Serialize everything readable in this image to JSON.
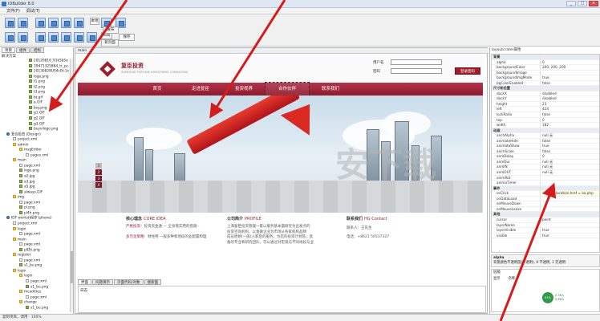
{
  "window": {
    "title": "IDBuilder 8.0",
    "min": "_",
    "max": "□",
    "close": "×"
  },
  "menu": [
    "文件(F)",
    "调试(T)"
  ],
  "toolbar": {
    "labels": [
      "本地",
      "布局",
      "发布",
      "保存",
      "新页面"
    ]
  },
  "left": {
    "tabs": [
      "项目",
      "组件",
      "结构"
    ],
    "heading": "解决方案",
    "tree": [
      {
        "label": "20120816_91k5b5o",
        "indent": 34,
        "kind": "img"
      },
      {
        "label": "39471325864_tr_pc",
        "indent": 34,
        "kind": "img"
      },
      {
        "label": "20130828US4c0t-1x",
        "indent": 34,
        "kind": "img"
      },
      {
        "label": "logo.png",
        "indent": 34,
        "kind": "img"
      },
      {
        "label": "t1.png",
        "indent": 34,
        "kind": "img"
      },
      {
        "label": "t2.png",
        "indent": 34,
        "kind": "img"
      },
      {
        "label": "t3.png",
        "indent": 34,
        "kind": "img"
      },
      {
        "label": "bt.gif",
        "indent": 34,
        "kind": "img"
      },
      {
        "label": "a.GIF",
        "indent": 34,
        "kind": "img"
      },
      {
        "label": "bsy.png",
        "indent": 34,
        "kind": "img"
      },
      {
        "label": "g1.GIF",
        "indent": 34,
        "kind": "img"
      },
      {
        "label": "g2.GIF",
        "indent": 34,
        "kind": "img"
      },
      {
        "label": "g3.GIF",
        "indent": 34,
        "kind": "img"
      },
      {
        "label": "buyvilogo.png",
        "indent": 34,
        "kind": "img"
      },
      {
        "label": "复合投资 (Design)",
        "indent": 6,
        "kind": "proj"
      },
      {
        "label": "project.xml",
        "indent": 14,
        "kind": "file"
      },
      {
        "label": "admin",
        "indent": 14,
        "kind": "folder"
      },
      {
        "label": "msgEditor",
        "indent": 22,
        "kind": "folder"
      },
      {
        "label": "pages.xml",
        "indent": 30,
        "kind": "file"
      },
      {
        "label": "main",
        "indent": 14,
        "kind": "folder"
      },
      {
        "label": "page.xml",
        "indent": 22,
        "kind": "file"
      },
      {
        "label": "logo.png",
        "indent": 22,
        "kind": "img"
      },
      {
        "label": "a2.jpg",
        "indent": 22,
        "kind": "img"
      },
      {
        "label": "a3.jpg",
        "indent": 22,
        "kind": "img"
      },
      {
        "label": "a5.jpg",
        "indent": 22,
        "kind": "img"
      },
      {
        "label": "always.GIF",
        "indent": 22,
        "kind": "img"
      },
      {
        "label": "img",
        "indent": 14,
        "kind": "folder"
      },
      {
        "label": "page.xml",
        "indent": 22,
        "kind": "file"
      },
      {
        "label": "pl.png",
        "indent": 22,
        "kind": "img"
      },
      {
        "label": "pl4h.png",
        "indent": 22,
        "kind": "img"
      },
      {
        "label": "IDF worksh程序 (phone)",
        "indent": 6,
        "kind": "proj"
      },
      {
        "label": "project.xml",
        "indent": 14,
        "kind": "file"
      },
      {
        "label": "login",
        "indent": 14,
        "kind": "folder"
      },
      {
        "label": "page.xml",
        "indent": 22,
        "kind": "file"
      },
      {
        "label": "main",
        "indent": 14,
        "kind": "folder"
      },
      {
        "label": "page.xml",
        "indent": 22,
        "kind": "file"
      },
      {
        "label": "plDti.png",
        "indent": 22,
        "kind": "img"
      },
      {
        "label": "register",
        "indent": 14,
        "kind": "folder"
      },
      {
        "label": "page.xml",
        "indent": 22,
        "kind": "file"
      },
      {
        "label": "s1_bu.png",
        "indent": 22,
        "kind": "img"
      },
      {
        "label": "login",
        "indent": 14,
        "kind": "folder"
      },
      {
        "label": "login",
        "indent": 22,
        "kind": "folder"
      },
      {
        "label": "page.xml",
        "indent": 30,
        "kind": "file"
      },
      {
        "label": "s1_bu.png",
        "indent": 30,
        "kind": "img"
      },
      {
        "label": "mcaddres",
        "indent": 22,
        "kind": "folder"
      },
      {
        "label": "page.xml",
        "indent": 30,
        "kind": "file"
      },
      {
        "label": "change",
        "indent": 22,
        "kind": "folder"
      },
      {
        "label": "s1_bu.png",
        "indent": 30,
        "kind": "img"
      }
    ]
  },
  "editor": {
    "tab": "main",
    "site": {
      "brand_cn": "复臣投资",
      "brand_en": "SHENGHAI FORTUNE INVESTMENT CONSULTING",
      "user_label": "用户名",
      "pass_label": "密码",
      "login_btn": "登录密码",
      "nav": [
        "首页",
        "走进复臣",
        "投资视界",
        "合作伙伴",
        "联系我们"
      ],
      "slides": [
        "1",
        "2",
        "3",
        "4"
      ],
      "col1_title": "核心理念",
      "col1_title_en": "CORE IDEA",
      "col1_lines": [
        {
          "tag": "严格投资：",
          "text": "投资资金通 — 全身落实用的措施 -"
        },
        {
          "tag": "多元化策略：",
          "text": "财经特 一般多种和地段的业配置和理"
        }
      ],
      "col2_title": "公司简介",
      "col2_title_en": "PROFILE",
      "col2_lines": [
        "上海复臣投资管理一家以服务基本面研究为出发点的",
        "投资咨询机构，以金融企业为市场从各家机构品牌",
        "成员原始(一般)入职后的服务，为您的投资计划等，具",
        "备的专业和研究团队，可以通过对宏观与不同地段与业"
      ],
      "col3_title": "联系我们",
      "col3_title_en": "HG Contact",
      "contact_person": "联系人：王先生",
      "phone": "电话：+8621 56537327"
    },
    "bottom_tabs": [
      "界面",
      "问题演示",
      "页面代码/对象",
      "搜索面"
    ],
    "console_text": "日志"
  },
  "properties": {
    "header": "layoutcrater属性",
    "rows": [
      {
        "k": "背景",
        "v": "",
        "cat": true
      },
      {
        "k": "alpha",
        "v": "0"
      },
      {
        "k": "backgroundColor",
        "v": "200, 200, 200"
      },
      {
        "k": "backgroundImage",
        "v": ""
      },
      {
        "k": "backgroundImgMode",
        "v": "true"
      },
      {
        "k": "bgColorEnabled",
        "v": "false"
      },
      {
        "k": "尺寸和位置",
        "v": "",
        "cat": true
      },
      {
        "k": "dockX",
        "v": "disabled"
      },
      {
        "k": "dockY",
        "v": "disabled"
      },
      {
        "k": "height",
        "v": "23"
      },
      {
        "k": "left",
        "v": "424"
      },
      {
        "k": "lockRatio",
        "v": "false"
      },
      {
        "k": "top",
        "v": "0"
      },
      {
        "k": "width",
        "v": "182"
      },
      {
        "k": "动画",
        "v": "",
        "cat": true
      },
      {
        "k": "anchAlpha",
        "v": "null 无"
      },
      {
        "k": "animateHide",
        "v": "false"
      },
      {
        "k": "animateShow",
        "v": "true"
      },
      {
        "k": "animScale",
        "v": "false"
      },
      {
        "k": "anmDelay",
        "v": "0"
      },
      {
        "k": "anmDur",
        "v": "null 无"
      },
      {
        "k": "anmIN",
        "v": "null 无"
      },
      {
        "k": "anmOUT",
        "v": "null 无"
      },
      {
        "k": "animRot",
        "v": ""
      },
      {
        "k": "animaTimer",
        "v": ""
      },
      {
        "k": "事件",
        "v": "",
        "cat": true
      },
      {
        "k": "onClick",
        "v": "window.location.href = aa.php",
        "hl": true
      },
      {
        "k": "onDataLoad",
        "v": ""
      },
      {
        "k": "onMouseDown",
        "v": ""
      },
      {
        "k": "onMouseLeave",
        "v": ""
      },
      {
        "k": "其他",
        "v": "",
        "cat": true
      },
      {
        "k": "cursor",
        "v": "point"
      },
      {
        "k": "layerName",
        "v": ""
      },
      {
        "k": "layerVisible",
        "v": "true"
      },
      {
        "k": "visible",
        "v": "true"
      }
    ],
    "desc_title": "alpha",
    "desc_text": "背景颜色不透明度(不透明), 0 不透明, 1 完透明",
    "bottom_header": "层级",
    "bottom_cols": [
      "显示",
      "名称"
    ]
  },
  "network": {
    "badge": "61%",
    "up": "0.3K/s",
    "down": "0.8K/s"
  },
  "status": "复制项目，调用 · 100%",
  "watermark": "安下载"
}
